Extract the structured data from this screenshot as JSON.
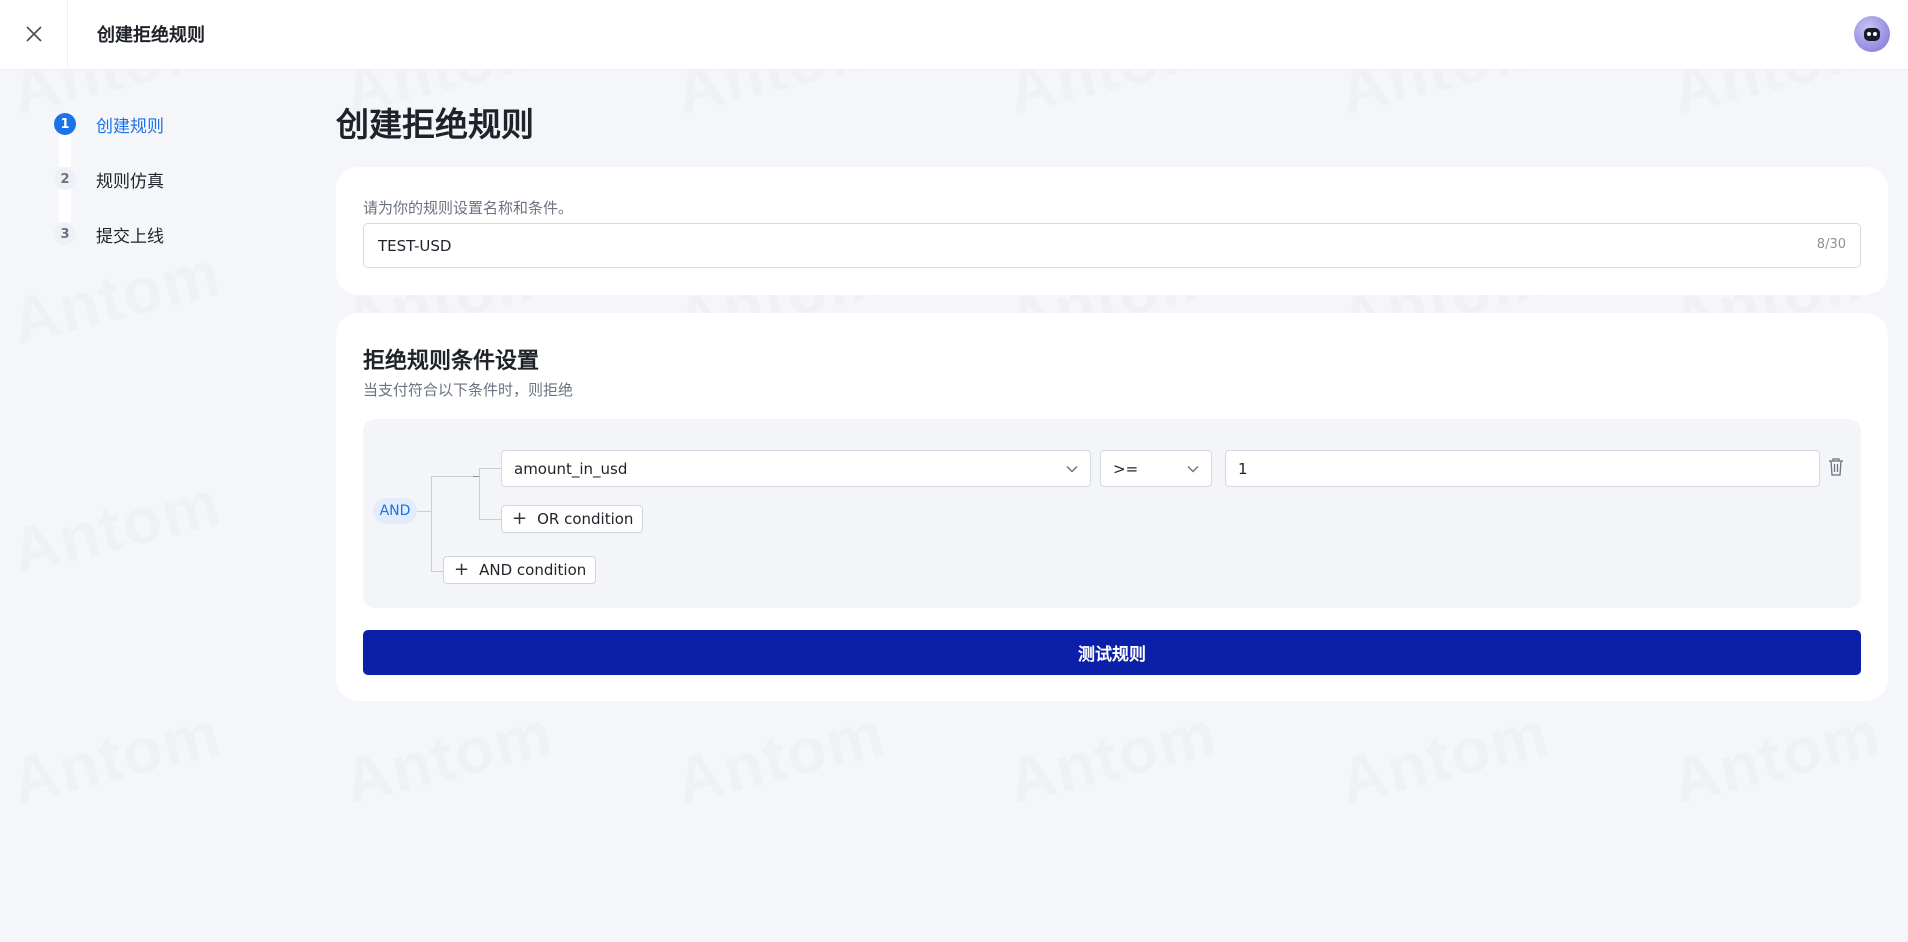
{
  "header": {
    "title": "创建拒绝规则",
    "close_icon": "close-icon",
    "avatar_icon": "robot-avatar"
  },
  "steps": [
    {
      "num": "1",
      "label": "创建规则",
      "active": true
    },
    {
      "num": "2",
      "label": "规则仿真",
      "active": false
    },
    {
      "num": "3",
      "label": "提交上线",
      "active": false
    }
  ],
  "page": {
    "title": "创建拒绝规则"
  },
  "name_card": {
    "hint": "请为你的规则设置名称和条件。",
    "name_value": "TEST-USD",
    "counter": "8/30"
  },
  "conditions": {
    "title": "拒绝规则条件设置",
    "subtitle": "当支付符合以下条件时，则拒绝",
    "logic": "AND",
    "rows": [
      {
        "field": "amount_in_usd",
        "operator": ">=",
        "value": "1"
      }
    ],
    "or_button": "OR condition",
    "and_button": "AND condition"
  },
  "actions": {
    "test_button": "测试规则"
  },
  "colors": {
    "primary": "#1a73e8",
    "button": "#0b1fa8",
    "background": "#f5f6fa"
  }
}
